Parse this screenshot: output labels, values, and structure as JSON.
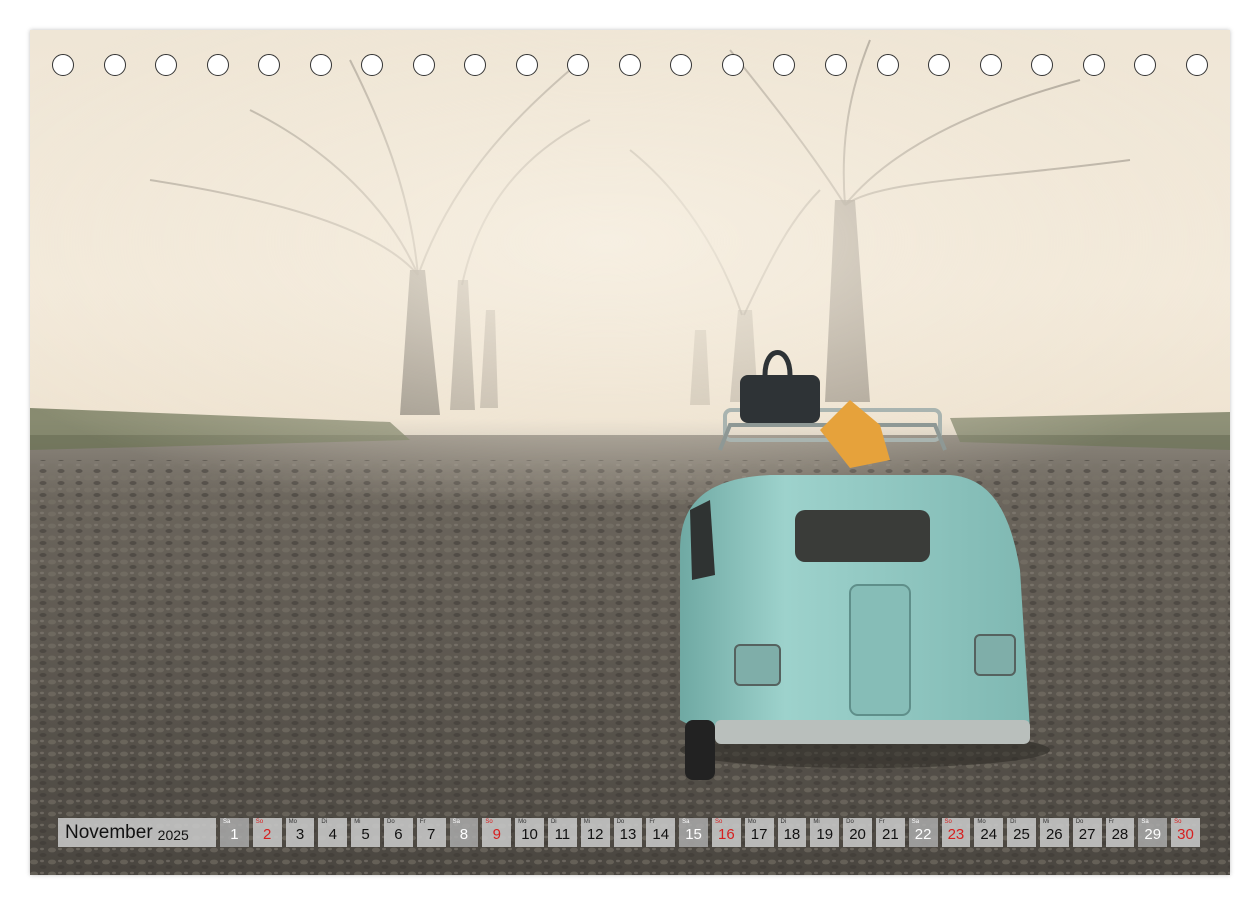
{
  "calendar": {
    "month": "November",
    "year": "2025",
    "days": [
      {
        "dow": "Sa",
        "num": "1",
        "type": "weekend"
      },
      {
        "dow": "So",
        "num": "2",
        "type": "sunday"
      },
      {
        "dow": "Mo",
        "num": "3",
        "type": "weekday"
      },
      {
        "dow": "Di",
        "num": "4",
        "type": "weekday"
      },
      {
        "dow": "Mi",
        "num": "5",
        "type": "weekday"
      },
      {
        "dow": "Do",
        "num": "6",
        "type": "weekday"
      },
      {
        "dow": "Fr",
        "num": "7",
        "type": "weekday"
      },
      {
        "dow": "Sa",
        "num": "8",
        "type": "weekend"
      },
      {
        "dow": "So",
        "num": "9",
        "type": "sunday"
      },
      {
        "dow": "Mo",
        "num": "10",
        "type": "weekday"
      },
      {
        "dow": "Di",
        "num": "11",
        "type": "weekday"
      },
      {
        "dow": "Mi",
        "num": "12",
        "type": "weekday"
      },
      {
        "dow": "Do",
        "num": "13",
        "type": "weekday"
      },
      {
        "dow": "Fr",
        "num": "14",
        "type": "weekday"
      },
      {
        "dow": "Sa",
        "num": "15",
        "type": "weekend"
      },
      {
        "dow": "So",
        "num": "16",
        "type": "sunday"
      },
      {
        "dow": "Mo",
        "num": "17",
        "type": "weekday"
      },
      {
        "dow": "Di",
        "num": "18",
        "type": "weekday"
      },
      {
        "dow": "Mi",
        "num": "19",
        "type": "weekday"
      },
      {
        "dow": "Do",
        "num": "20",
        "type": "weekday"
      },
      {
        "dow": "Fr",
        "num": "21",
        "type": "weekday"
      },
      {
        "dow": "Sa",
        "num": "22",
        "type": "weekend"
      },
      {
        "dow": "So",
        "num": "23",
        "type": "sunday"
      },
      {
        "dow": "Mo",
        "num": "24",
        "type": "weekday"
      },
      {
        "dow": "Di",
        "num": "25",
        "type": "weekday"
      },
      {
        "dow": "Mi",
        "num": "26",
        "type": "weekday"
      },
      {
        "dow": "Do",
        "num": "27",
        "type": "weekday"
      },
      {
        "dow": "Fr",
        "num": "28",
        "type": "weekday"
      },
      {
        "dow": "Sa",
        "num": "29",
        "type": "weekend"
      },
      {
        "dow": "So",
        "num": "30",
        "type": "sunday"
      }
    ]
  },
  "binding_hole_count": 23,
  "colors": {
    "sky": "#f1e8d8",
    "road": "#575249",
    "car": "#8fc6c0",
    "sunday_red": "#d62020"
  }
}
